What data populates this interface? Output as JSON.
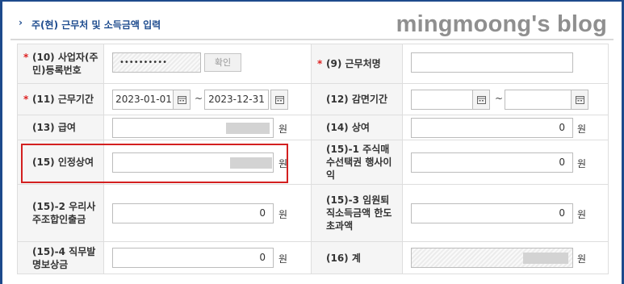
{
  "section": {
    "title": "주(현) 근무처 및 소득금액 입력"
  },
  "watermark": "mingmoong's blog",
  "rows": {
    "r1": {
      "left_label": "(10) 사업자(주민)등록번호",
      "masked_value": "••••••••••",
      "confirm_button": "확인",
      "right_label": "(9) 근무처명",
      "right_value": ""
    },
    "r2": {
      "left_label": "(11) 근무기간",
      "start_date": "2023-01-01",
      "end_date": "2023-12-31",
      "tilde": "~",
      "right_label": "(12) 감면기간",
      "right_start": "",
      "right_end": ""
    },
    "r3": {
      "left_label": "(13) 급여",
      "left_unit": "원",
      "right_label": "(14) 상여",
      "right_value": "0",
      "right_unit": "원"
    },
    "r4": {
      "left_label": "(15) 인정상여",
      "left_unit": "원",
      "right_label": "(15)-1 주식매수선택권 행사이익",
      "right_value": "0",
      "right_unit": "원"
    },
    "r5": {
      "left_label": "(15)-2 우리사주조합인출금",
      "left_value": "0",
      "left_unit": "원",
      "right_label": "(15)-3 임원퇴직소득금액 한도초과액",
      "right_value": "0",
      "right_unit": "원"
    },
    "r6": {
      "left_label": "(15)-4 직무발명보상금",
      "left_value": "0",
      "left_unit": "원",
      "right_label": "(16) 계",
      "right_unit": "원"
    }
  },
  "required_mark": "*",
  "colors": {
    "accent": "#1e4c8f",
    "frame": "#1d4a8c",
    "highlight": "#d32020",
    "required": "#dd2222"
  }
}
